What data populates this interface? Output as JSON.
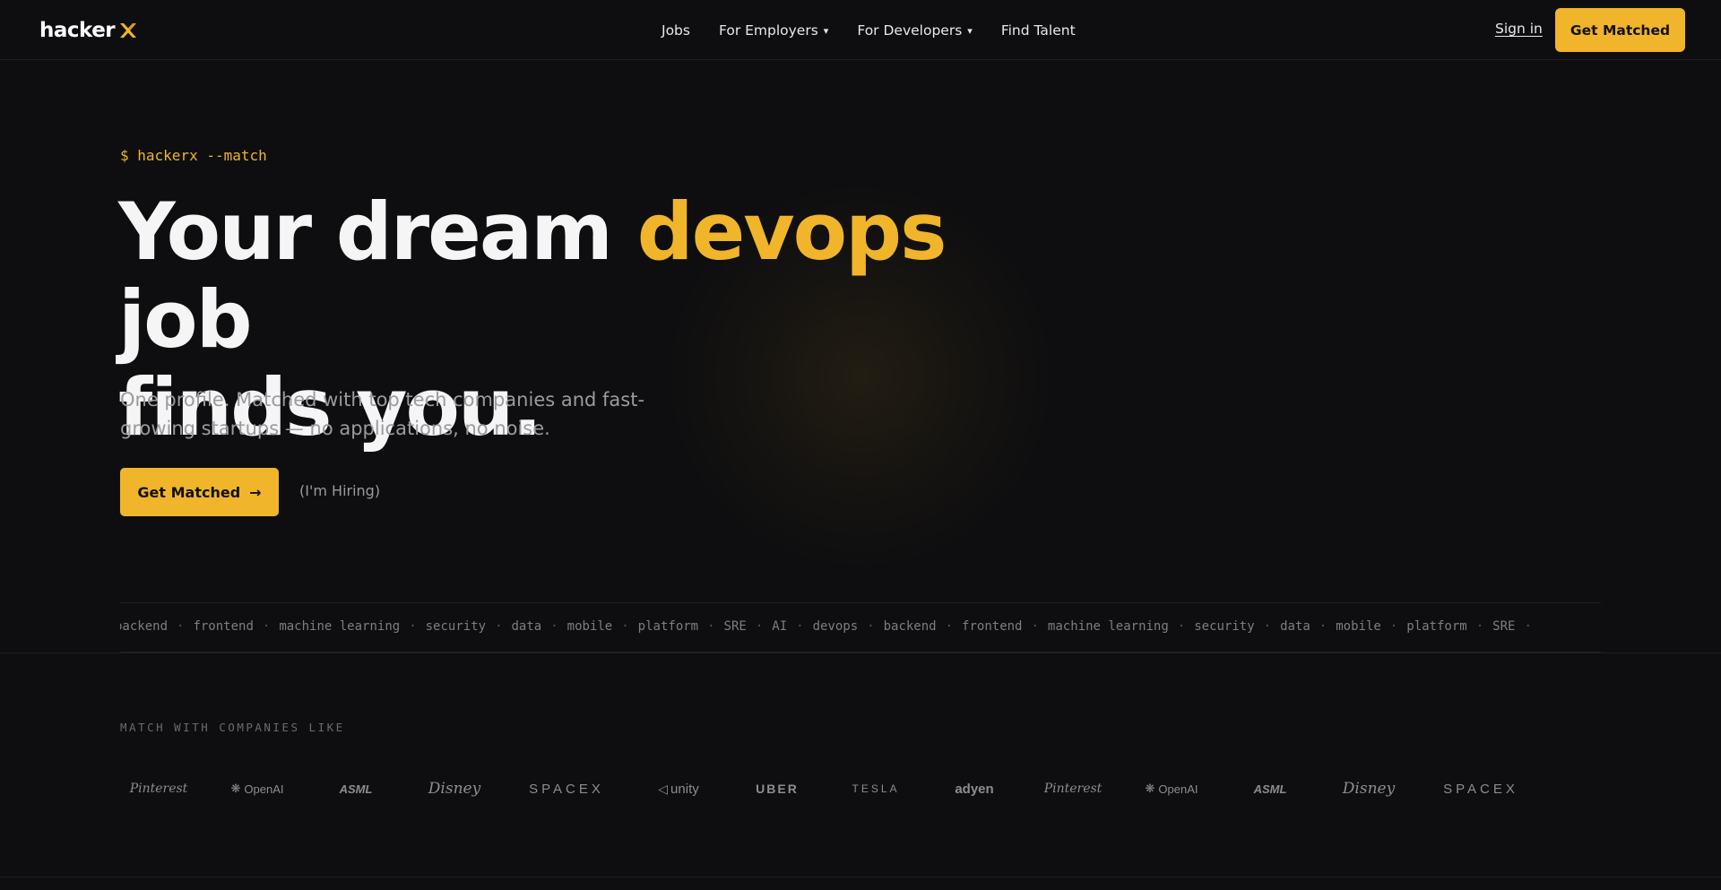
{
  "nav": {
    "logo_text": "hacker",
    "links": [
      {
        "label": "Jobs",
        "caret": ""
      },
      {
        "label": "For Employers",
        "caret": "▾"
      },
      {
        "label": "For Developers",
        "caret": "▾"
      },
      {
        "label": "Find Talent",
        "caret": ""
      }
    ],
    "signin_label": "Sign in",
    "cta_label": "Get Matched"
  },
  "hero": {
    "prompt": "$ hackerx --match",
    "headline_before": "Your dream ",
    "headline_accent": "devops",
    "headline_after_line1": " job",
    "headline_line2": "finds you.",
    "subhead": "One profile. Matched with top tech companies and fast-growing startups — no applications, no noise.",
    "cta_label": "Get Matched",
    "cta_arrow": "→",
    "secondary_label": "(I'm Hiring)"
  },
  "ticker": {
    "items": [
      "backend",
      "frontend",
      "machine learning",
      "security",
      "data",
      "mobile",
      "platform",
      "SRE",
      "AI",
      "devops",
      "backend",
      "frontend",
      "machine learning",
      "security",
      "data",
      "mobile",
      "platform",
      "SRE"
    ],
    "separator": "·"
  },
  "companies": {
    "label": "MATCH WITH COMPANIES LIKE",
    "logos": [
      {
        "name": "Pinterest",
        "style": "pinterest"
      },
      {
        "name": "OpenAI",
        "style": "openai"
      },
      {
        "name": "ASML",
        "style": "asml"
      },
      {
        "name": "Disney",
        "style": "disney"
      },
      {
        "name": "SPACEX",
        "style": "spacex"
      },
      {
        "name": "unity",
        "style": "unity"
      },
      {
        "name": "UBER",
        "style": "uber"
      },
      {
        "name": "TESLA",
        "style": "tesla"
      },
      {
        "name": "adyen",
        "style": "adyen"
      },
      {
        "name": "Pinterest",
        "style": "pinterest"
      },
      {
        "name": "OpenAI",
        "style": "openai"
      },
      {
        "name": "ASML",
        "style": "asml"
      },
      {
        "name": "Disney",
        "style": "disney"
      },
      {
        "name": "SPACEX",
        "style": "spacex"
      }
    ]
  },
  "colors": {
    "accent": "#f0b52a",
    "background": "#0e0e10",
    "text": "#f5f5f5",
    "muted": "#9a9a9f"
  }
}
